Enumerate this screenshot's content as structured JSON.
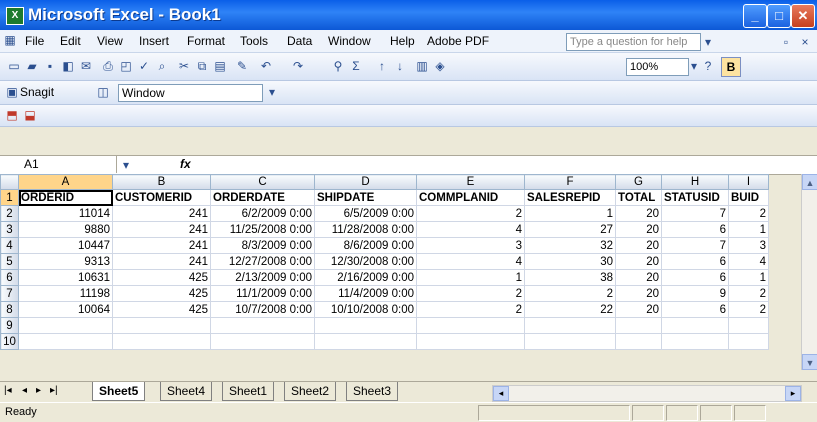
{
  "window": {
    "title": "Microsoft Excel - Book1"
  },
  "menu": [
    "File",
    "Edit",
    "View",
    "Insert",
    "Format",
    "Tools",
    "Data",
    "Window",
    "Help",
    "Adobe PDF"
  ],
  "help_search": {
    "placeholder": "Type a question for help"
  },
  "toolbar": {
    "zoom": "100%",
    "bold_label": "B"
  },
  "snagit": {
    "label": "Snagit",
    "capture_mode": "Window"
  },
  "formula_bar": {
    "name_box": "A1",
    "fx_label": "fx",
    "content": ""
  },
  "sheet": {
    "columns": [
      "A",
      "B",
      "C",
      "D",
      "E",
      "F",
      "G",
      "H",
      "I"
    ],
    "rows": [
      [
        "ORDERID",
        "CUSTOMERID",
        "ORDERDATE",
        "SHIPDATE",
        "COMMPLANID",
        "SALESREPID",
        "TOTAL",
        "STATUSID",
        "BUID"
      ],
      [
        "11014",
        "241",
        "6/2/2009 0:00",
        "6/5/2009 0:00",
        "2",
        "1",
        "20",
        "7",
        "2"
      ],
      [
        "9880",
        "241",
        "11/25/2008 0:00",
        "11/28/2008 0:00",
        "4",
        "27",
        "20",
        "6",
        "1"
      ],
      [
        "10447",
        "241",
        "8/3/2009 0:00",
        "8/6/2009 0:00",
        "3",
        "32",
        "20",
        "7",
        "3"
      ],
      [
        "9313",
        "241",
        "12/27/2008 0:00",
        "12/30/2008 0:00",
        "4",
        "30",
        "20",
        "6",
        "4"
      ],
      [
        "10631",
        "425",
        "2/13/2009 0:00",
        "2/16/2009 0:00",
        "1",
        "38",
        "20",
        "6",
        "1"
      ],
      [
        "11198",
        "425",
        "11/1/2009 0:00",
        "11/4/2009 0:00",
        "2",
        "2",
        "20",
        "9",
        "2"
      ],
      [
        "10064",
        "425",
        "10/7/2008 0:00",
        "10/10/2008 0:00",
        "2",
        "22",
        "20",
        "6",
        "2"
      ],
      [
        "",
        "",
        "",
        "",
        "",
        "",
        "",
        "",
        ""
      ],
      [
        "",
        "",
        "",
        "",
        "",
        "",
        "",
        "",
        ""
      ]
    ],
    "row_numbers": [
      "1",
      "2",
      "3",
      "4",
      "5",
      "6",
      "7",
      "8",
      "9",
      "10"
    ]
  },
  "tabs": [
    "Sheet5",
    "Sheet4",
    "Sheet1",
    "Sheet2",
    "Sheet3"
  ],
  "status": {
    "text": "Ready"
  },
  "colors": {
    "title_bar": "#0a5fe8",
    "selected_header": "#ffd58a"
  }
}
